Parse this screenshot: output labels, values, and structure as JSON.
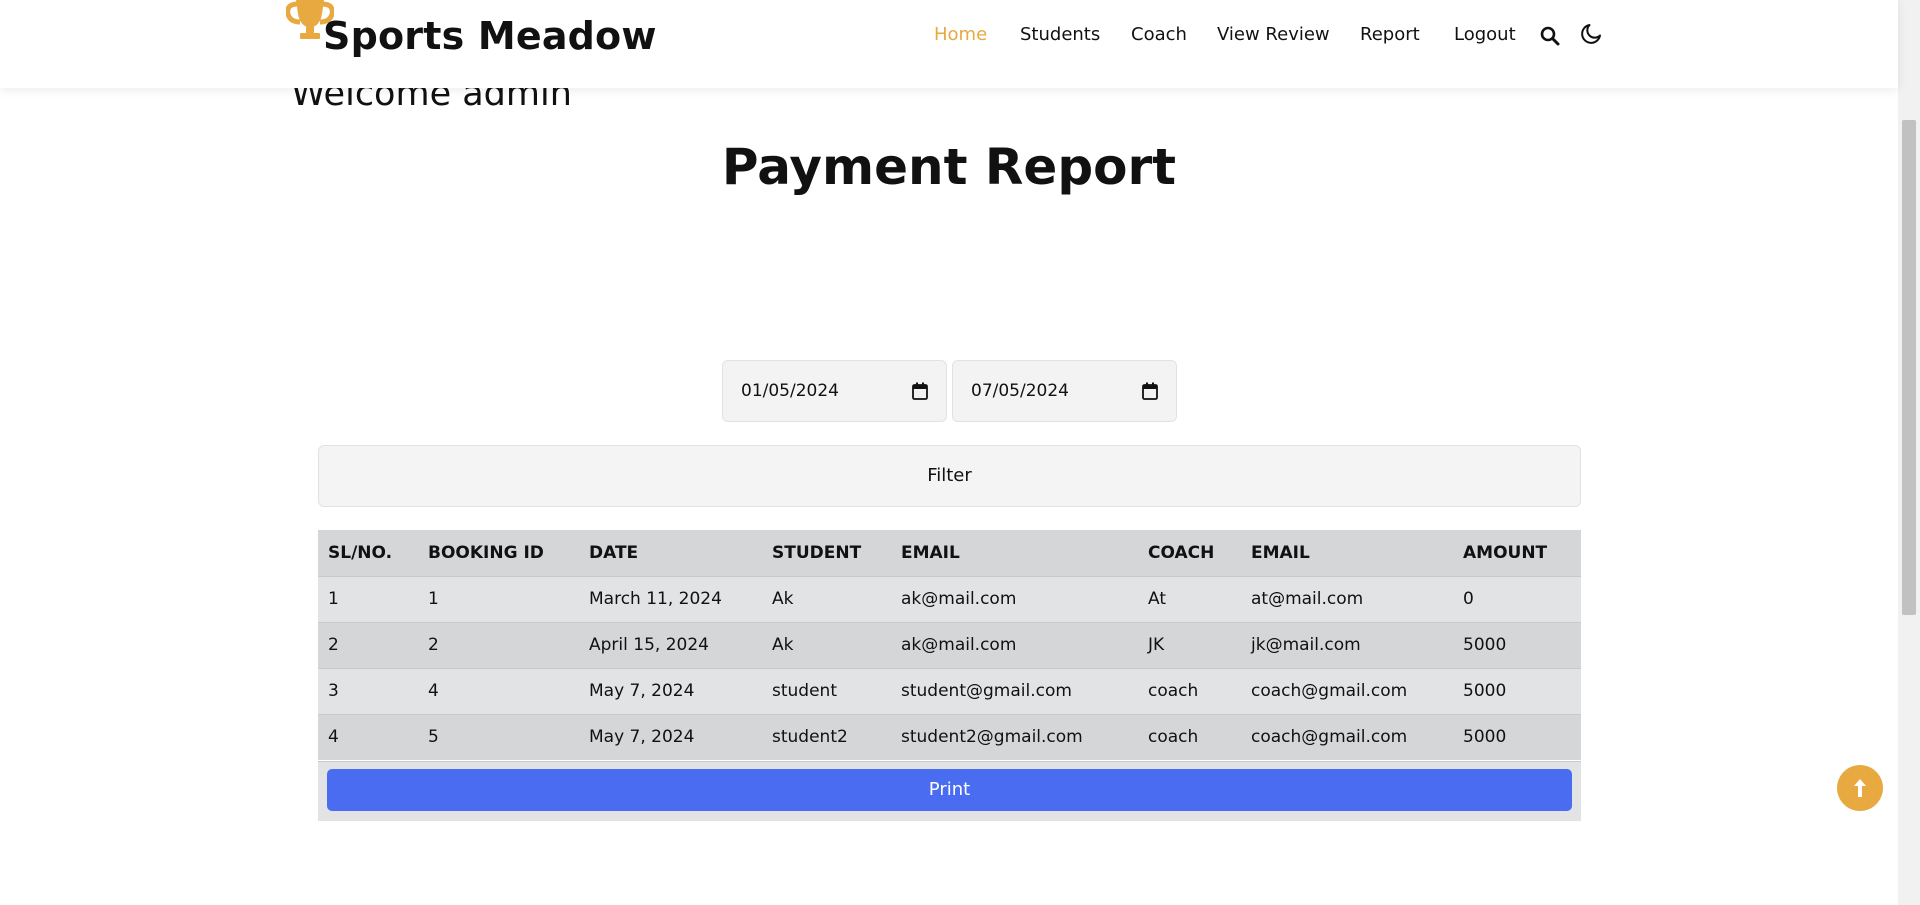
{
  "header": {
    "brand": "Sports Meadow",
    "brand_color": "#e8a940",
    "nav": [
      {
        "label": "Home",
        "active": true
      },
      {
        "label": "Students",
        "active": false
      },
      {
        "label": "Coach",
        "active": false
      },
      {
        "label": "View Review",
        "active": false
      },
      {
        "label": "Report",
        "active": false
      },
      {
        "label": "Logout",
        "active": false
      }
    ],
    "icons": [
      "search-icon",
      "moon-icon"
    ]
  },
  "welcome": "Welcome admin",
  "page_title": "Payment Report",
  "filter": {
    "from_date": "01/05/2024",
    "to_date": "07/05/2024",
    "button_label": "Filter"
  },
  "table": {
    "headers": [
      "SL/NO.",
      "BOOKING ID",
      "DATE",
      "STUDENT",
      "EMAIL",
      "COACH",
      "EMAIL",
      "AMOUNT"
    ],
    "rows": [
      [
        "1",
        "1",
        "March 11, 2024",
        "Ak",
        "ak@mail.com",
        "At",
        "at@mail.com",
        "0"
      ],
      [
        "2",
        "2",
        "April 15, 2024",
        "Ak",
        "ak@mail.com",
        "JK",
        "jk@mail.com",
        "5000"
      ],
      [
        "3",
        "4",
        "May 7, 2024",
        "student",
        "student@gmail.com",
        "coach",
        "coach@gmail.com",
        "5000"
      ],
      [
        "4",
        "5",
        "May 7, 2024",
        "student2",
        "student2@gmail.com",
        "coach",
        "coach@gmail.com",
        "5000"
      ]
    ]
  },
  "print_label": "Print",
  "print_color": "#4a6cf1",
  "back_to_top_icon": "arrow-up-icon"
}
